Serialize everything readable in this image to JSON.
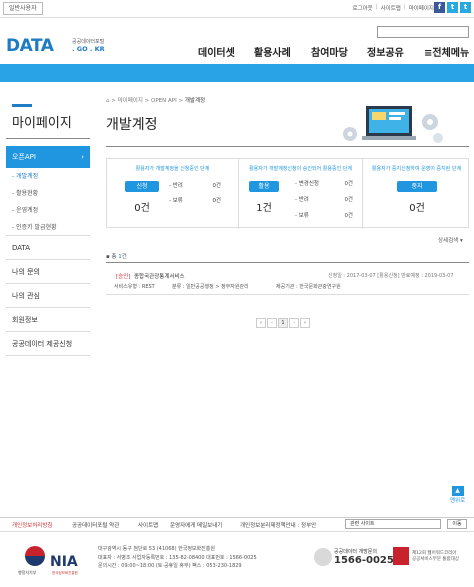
{
  "topbar": {
    "user_type": "일반사용자",
    "links": [
      "로그아웃",
      "사이트맵",
      "마이페이지"
    ],
    "social": [
      {
        "name": "facebook-icon",
        "glyph": "f",
        "color": "#3b5998"
      },
      {
        "name": "twitter-icon",
        "glyph": "t",
        "color": "#2aa9e0"
      },
      {
        "name": "twitter-alt-icon",
        "glyph": "t",
        "color": "#2aa9e0"
      }
    ]
  },
  "header": {
    "logo": "DATA",
    "logo_sub1": "공공데이터포털",
    "logo_sub2": ". GO . KR",
    "nav": [
      "데이터셋",
      "활용사례",
      "참여마당",
      "정보공유",
      "≡전체메뉴"
    ]
  },
  "sidebar": {
    "title": "마이페이지",
    "active": "오픈API",
    "active_arrow": "›",
    "subitems": [
      "- 개발계정",
      "- 활용현황",
      "- 운영계정",
      "- 인증키 발급현황"
    ],
    "items": [
      "DATA",
      "나의 문의",
      "나의 관심",
      "회원정보",
      "공공데이터 제공신청"
    ]
  },
  "main": {
    "breadcrumb": [
      "마이페이지",
      "OPEN API",
      "개발계정"
    ],
    "title": "개발계정",
    "status_boxes": [
      {
        "caption": "활용자가 개발계정을 신청중인 단계",
        "badge": "신청",
        "badge_color": "#2196e0",
        "count": "0건",
        "rows": [
          {
            "label": "- 반려",
            "value": "0건"
          },
          {
            "label": "- 보류",
            "value": "0건"
          }
        ]
      },
      {
        "caption": "활용자가 개발계정신청이 승인되어 활용중인 단계",
        "badge": "활용",
        "badge_color": "#2196e0",
        "count": "1건",
        "rows": [
          {
            "label": "- 변경신청",
            "value": "0건"
          },
          {
            "label": "- 반려",
            "value": "0건"
          },
          {
            "label": "- 보류",
            "value": "0건"
          }
        ]
      },
      {
        "caption": "활용자가 중지신청하여 운영이 중지된 단계",
        "badge": "중지",
        "badge_color": "#2196e0",
        "count": "0건",
        "rows": []
      }
    ],
    "detail_link": "상세검색 ▾",
    "total_label": "총",
    "total_count": "1",
    "total_unit": "건",
    "list": [
      {
        "status": "[승인]",
        "title": "종합국관광통계서비스",
        "date": "신청일 : 2017-03-07 [활용신청]  만료예정 : 2019-03-07",
        "service_type": "서비스유형 : REST",
        "category": "분류 : 일반공공행정 > 정부자원관리",
        "provider": "제공기관 : 한국문화관광연구원"
      }
    ],
    "pager": [
      "«",
      "‹",
      "1",
      "›",
      "»"
    ]
  },
  "top_button": "맨위로",
  "footer": {
    "links": [
      "개인정보처리방침",
      "공공데이터포털 약관",
      "사이트맵",
      "운영자에게 메일보내기",
      "개인정보분리제정책안내 : 정부안"
    ],
    "related_site": "관련 사이트",
    "go": "이동",
    "logo1_caption": "행정자치부",
    "nia": "NIA",
    "nia_caption": "한국정보화진흥원",
    "address": [
      "대구광역시 동구 첨단로 53 (41068) 한국정보화진흥원",
      "대표자 : 서병조    사업자등록번호 : 135-82-08400  대표번호 : 1566-0025",
      "문의시간 : 09:00~18:00 (토·공휴일 휴무)  팩스 : 053-230-1829"
    ],
    "call_label": "공공데이터 개방문의",
    "call_number": "1566-0025",
    "award_lines": [
      "제12회 웹어워드코리아",
      "공공서비스부문 통합대상"
    ]
  },
  "colors": {
    "brand": "#1f7bc4",
    "accent": "#2196e0",
    "bar": "#29a3e6"
  }
}
